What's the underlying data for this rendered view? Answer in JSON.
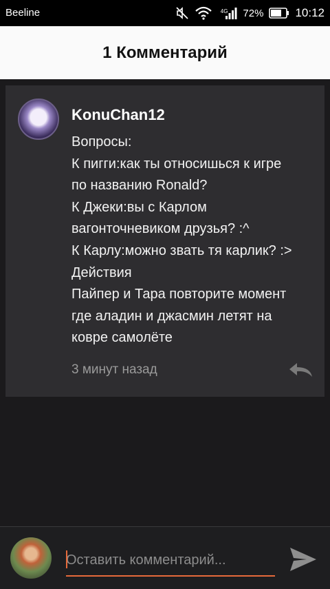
{
  "status_bar": {
    "carrier": "Beeline",
    "network": "4G",
    "battery_percent": "72%",
    "time": "10:12"
  },
  "header": {
    "title": "1 Комментарий"
  },
  "comment": {
    "username": "KonuChan12",
    "lines": [
      "Вопросы:",
      "К пигги:как ты относишься к игре",
      "по названию Ronald?",
      "К Джеки:вы с Карлом",
      "вагонточневиком друзья? :^",
      "К Карлу:можно звать тя карлик? :>",
      "Действия",
      "Пайпер и Тара повторите момент",
      "где аладин и джасмин летят на",
      "ковре самолёте"
    ],
    "timestamp": "3 минут назад"
  },
  "input": {
    "placeholder": "Оставить комментарий..."
  },
  "colors": {
    "accent": "#e76a3b",
    "card_bg": "#2e2d30",
    "page_bg": "#1b1a1c",
    "header_bg": "#fafafa"
  },
  "icons": {
    "mute": "mute-icon",
    "wifi": "wifi-icon",
    "signal": "signal-icon",
    "battery": "battery-icon",
    "reply": "reply-icon",
    "send": "send-icon"
  }
}
